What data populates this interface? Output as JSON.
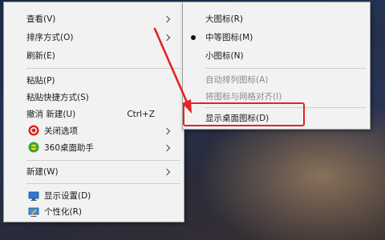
{
  "context_menu": {
    "items": [
      {
        "label": "查看(V)"
      },
      {
        "label": "排序方式(O)"
      },
      {
        "label": "刷新(E)"
      },
      {
        "label": "粘贴(P)"
      },
      {
        "label": "粘贴快捷方式(S)"
      },
      {
        "label": "撤消 新建(U)",
        "shortcut": "Ctrl+Z"
      },
      {
        "label": "关闭选项",
        "icon": "red-power-icon"
      },
      {
        "label": "360桌面助手",
        "icon": "360-assistant-icon"
      },
      {
        "label": "新建(W)"
      },
      {
        "label": "显示设置(D)",
        "icon": "display-settings-icon"
      },
      {
        "label": "个性化(R)",
        "icon": "personalize-icon"
      }
    ]
  },
  "view_submenu": {
    "items": [
      {
        "label": "大图标(R)"
      },
      {
        "label": "中等图标(M)",
        "checked": true
      },
      {
        "label": "小图标(N)"
      },
      {
        "label": "自动排列图标(A)",
        "disabled": true
      },
      {
        "label": "将图标与网格对齐(I)",
        "disabled": true
      },
      {
        "label": "显示桌面图标(D)"
      }
    ]
  },
  "colors": {
    "annotation": "#e42222",
    "menu_background": "#f2f2f2",
    "disabled_text": "#8a8a8a"
  }
}
